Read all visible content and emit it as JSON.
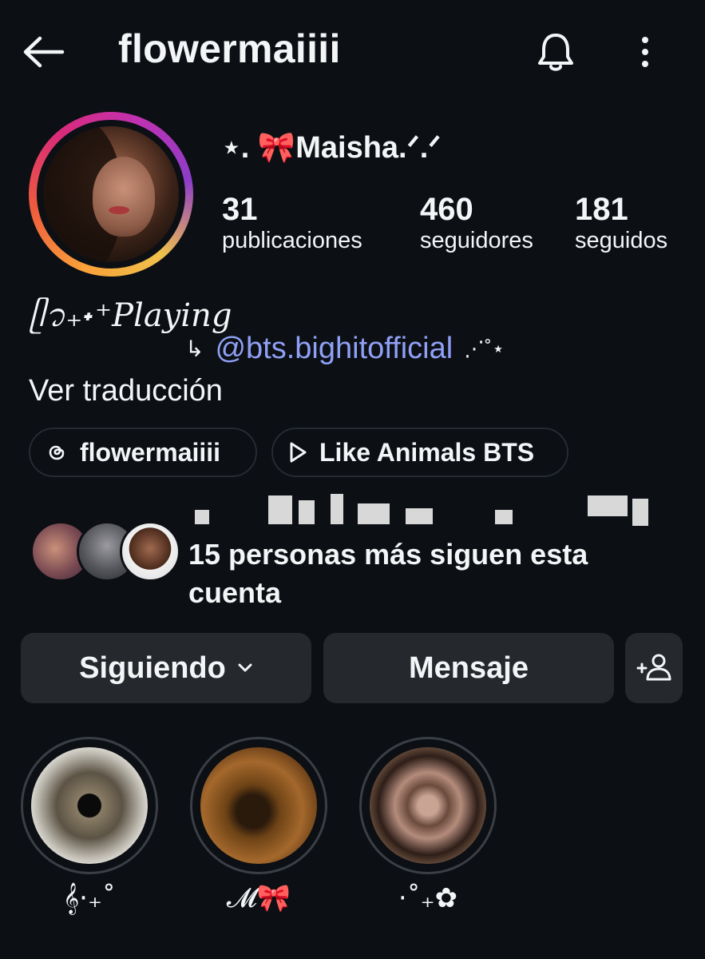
{
  "header": {
    "back_icon": "arrow-left-icon",
    "title": "flowermaiiii",
    "bell_icon": "bell-icon",
    "more_icon": "more-vertical-icon"
  },
  "profile": {
    "display_name": "⋆. 🎀Maisha.ᐟ.ᐟ",
    "stats": [
      {
        "count": "31",
        "label": "publicaciones"
      },
      {
        "count": "460",
        "label": "seguidores"
      },
      {
        "count": "181",
        "label": "seguidos"
      }
    ]
  },
  "bio": {
    "line1": "ᥫ᭡₊˖⁺Playing",
    "arrow": "↳",
    "mention": "@bts.bighitofficial",
    "decor": "⋰˚⋆",
    "translate": "Ver traducción"
  },
  "links": {
    "threads_icon": "threads-icon",
    "threads_label": "flowermaiiii",
    "music_icon": "play-icon",
    "music_label": "Like Animals BTS"
  },
  "followed_by": {
    "text": "15 personas más siguen esta cuenta"
  },
  "actions": {
    "following_label": "Siguiendo",
    "chevron_icon": "chevron-down-icon",
    "message_label": "Mensaje",
    "add_user_icon": "add-person-icon"
  },
  "highlights": [
    {
      "label": "𝄞·₊˚"
    },
    {
      "label": "𝓜🎀"
    },
    {
      "label": "·˚₊✿"
    }
  ],
  "colors": {
    "background": "#0c0f14",
    "mention": "#8fa0f5",
    "button": "#25282d"
  }
}
